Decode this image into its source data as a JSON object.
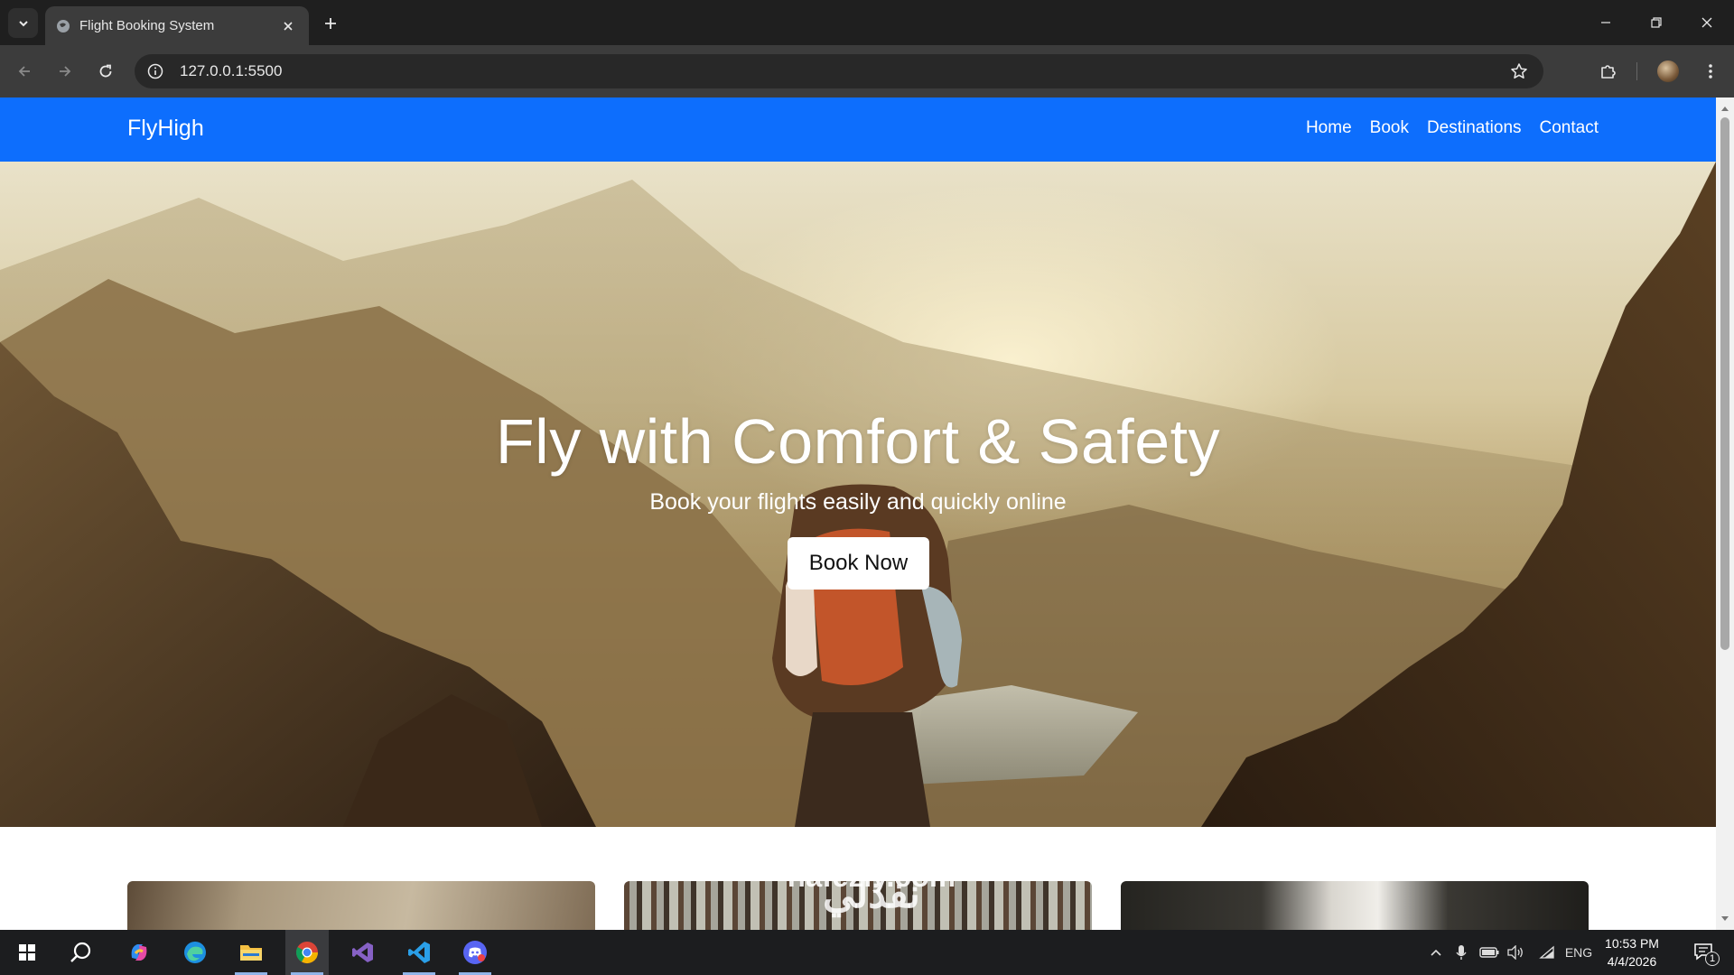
{
  "browser": {
    "tab_title": "Flight Booking System",
    "url": "127.0.0.1:5500"
  },
  "site": {
    "brand": "FlyHigh",
    "nav": [
      {
        "label": "Home"
      },
      {
        "label": "Book"
      },
      {
        "label": "Destinations"
      },
      {
        "label": "Contact"
      }
    ],
    "hero": {
      "title": "Fly with Comfort & Safety",
      "subtitle": "Book your flights easily and quickly online",
      "button": "Book Now"
    },
    "accent_color": "#0d6efd"
  },
  "watermark": {
    "arabic": "نفذلي",
    "latin": "nafezly.com"
  },
  "taskbar": {
    "apps": [
      "windows-start",
      "search",
      "copilot",
      "edge",
      "file-explorer",
      "chrome",
      "visual-studio",
      "vscode",
      "discord"
    ],
    "tray": {
      "language": "ENG",
      "time": "10:53 PM",
      "date": "4/4/2026",
      "notification_count": "1"
    }
  }
}
